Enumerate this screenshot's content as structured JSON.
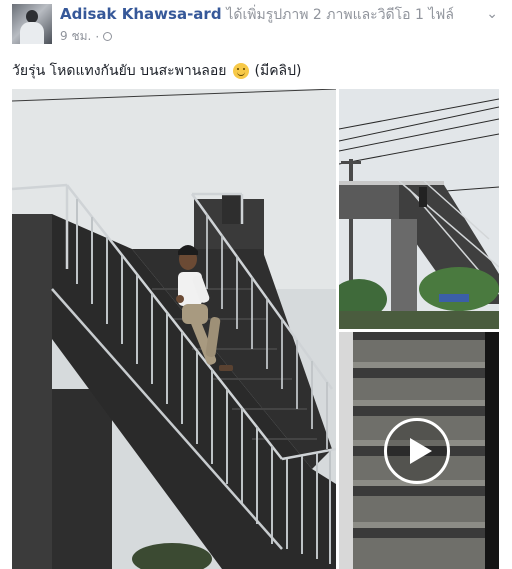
{
  "post": {
    "author": "Adisak Khawsa-ard",
    "action": "ได้เพิ่มรูปภาพ 2 ภาพและวิดีโอ 1 ไฟล์",
    "time": "9 ชม.",
    "dot": "·",
    "text": "วัยรุ่น โหดแทงกันยับ บนสะพานลอย",
    "text_suffix": "(มีคลิป)",
    "menu_icon": "chevron-down-icon",
    "privacy_icon": "globe-icon",
    "emoji_icon": "smile-emoji-icon"
  },
  "media": [
    {
      "kind": "photo",
      "icon": "photo-tile"
    },
    {
      "kind": "photo",
      "icon": "photo-tile"
    },
    {
      "kind": "video",
      "icon": "play-icon"
    }
  ],
  "colors": {
    "author": "#365899",
    "meta": "#90949c",
    "text": "#1d2129"
  }
}
